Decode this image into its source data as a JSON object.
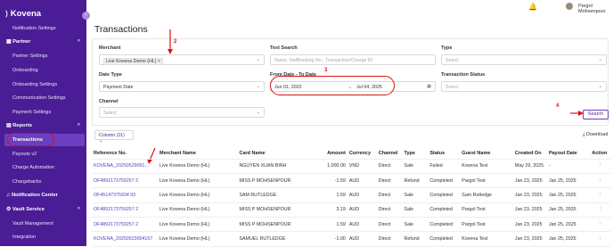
{
  "brand": {
    "name": "Kovena",
    "accent": "#4a1d96"
  },
  "sidebar": {
    "items": [
      {
        "label": "Notification Settings",
        "type": "item"
      },
      {
        "label": "Partner",
        "type": "section",
        "icon": "grid-icon"
      },
      {
        "label": "Partner Settings",
        "type": "item"
      },
      {
        "label": "Onboarding",
        "type": "item"
      },
      {
        "label": "Onboarding Settings",
        "type": "item"
      },
      {
        "label": "Communication Settings",
        "type": "item"
      },
      {
        "label": "Payment Settings",
        "type": "item"
      },
      {
        "label": "Reports",
        "type": "section",
        "icon": "chart-icon"
      },
      {
        "label": "Transactions",
        "type": "item",
        "active": true
      },
      {
        "label": "Payouts v2",
        "type": "item"
      },
      {
        "label": "Charge Automation",
        "type": "item"
      },
      {
        "label": "Chargebacks",
        "type": "item"
      },
      {
        "label": "Notification Center",
        "type": "section",
        "icon": "bell-icon"
      },
      {
        "label": "Vault Service",
        "type": "section",
        "icon": "gear-icon"
      },
      {
        "label": "Vault Management",
        "type": "item"
      },
      {
        "label": "Integration",
        "type": "item"
      }
    ]
  },
  "topbar": {
    "user_name": "Pargol Mohsenpour"
  },
  "page": {
    "title": "Transactions"
  },
  "filters": {
    "merchant_label": "Merchant",
    "merchant_value": "Live Kovena Demo (HL)",
    "text_search_label": "Text Search",
    "text_search_placeholder": "Name, RefBooking No , Transaction/Charge ID",
    "type_label": "Type",
    "type_placeholder": "Select",
    "date_type_label": "Date Type",
    "date_type_value": "Payment Date",
    "date_range_label": "From Date - To Date",
    "date_from": "Jun 01, 2022",
    "date_arrow": "→",
    "date_to": "Jul 04, 2025",
    "status_label": "Transaction Status",
    "status_placeholder": "Select",
    "channel_label": "Channel",
    "channel_placeholder": "Select",
    "search_button": "Search"
  },
  "annotations": {
    "n2": "2",
    "n3": "3",
    "n4": "4"
  },
  "toolbar": {
    "column_button": "Column (11)",
    "download": "Download"
  },
  "table": {
    "headers": [
      "Reference No.",
      "Merchant Name",
      "Card Name",
      "Amount",
      "Currency",
      "Channel",
      "Type",
      "Status",
      "Guest Name",
      "Created On",
      "Payout Date",
      "Action"
    ],
    "rows": [
      [
        "KOVENA_20250529091...",
        "Live Kovena Demo (HL)",
        "NGUYEN XUAN BINH",
        "1,000.00",
        "VND",
        "Direct",
        "Sale",
        "Failed",
        "Kovena Test",
        "May 29, 2025",
        "-",
        "⋮"
      ],
      [
        "OF4892173759257 2",
        "Live Kovena Demo (HL)",
        "MISS P MOHSENPOUR",
        "-1.59",
        "AUD",
        "Direct",
        "Refund",
        "Completed",
        "Pargol Test",
        "Jan 23, 2025",
        "Jan 25, 2025",
        "⋮"
      ],
      [
        "OF45147375934 93",
        "Live Kovena Demo (HL)",
        "SAM RUTLEDGE",
        "1.59",
        "AUD",
        "Direct",
        "Sale",
        "Completed",
        "Sam Rutledge",
        "Jan 23, 2025",
        "Jan 25, 2025",
        "⋮"
      ],
      [
        "OF4892173759257 2",
        "Live Kovena Demo (HL)",
        "MISS P MOHSENPOUR",
        "3.19",
        "AUD",
        "Direct",
        "Sale",
        "Completed",
        "Pargol Test",
        "Jan 23, 2025",
        "Jan 25, 2025",
        "⋮"
      ],
      [
        "OF4892173759257 2",
        "Live Kovena Demo (HL)",
        "MISS P MOHSENPOUR",
        "1.59",
        "AUD",
        "Direct",
        "Sale",
        "Completed",
        "Pargol Test",
        "Jan 23, 2025",
        "Jan 25, 2025",
        "⋮"
      ],
      [
        "KOVENA_20250523004157",
        "Live Kovena Demo (HL)",
        "SAMUEL RUTLEDGE",
        "-1.00",
        "AUD",
        "Direct",
        "Refund",
        "Completed",
        "Kovena Test",
        "Jan 23, 2025",
        "Jan 25, 2025",
        "⋮"
      ]
    ]
  }
}
